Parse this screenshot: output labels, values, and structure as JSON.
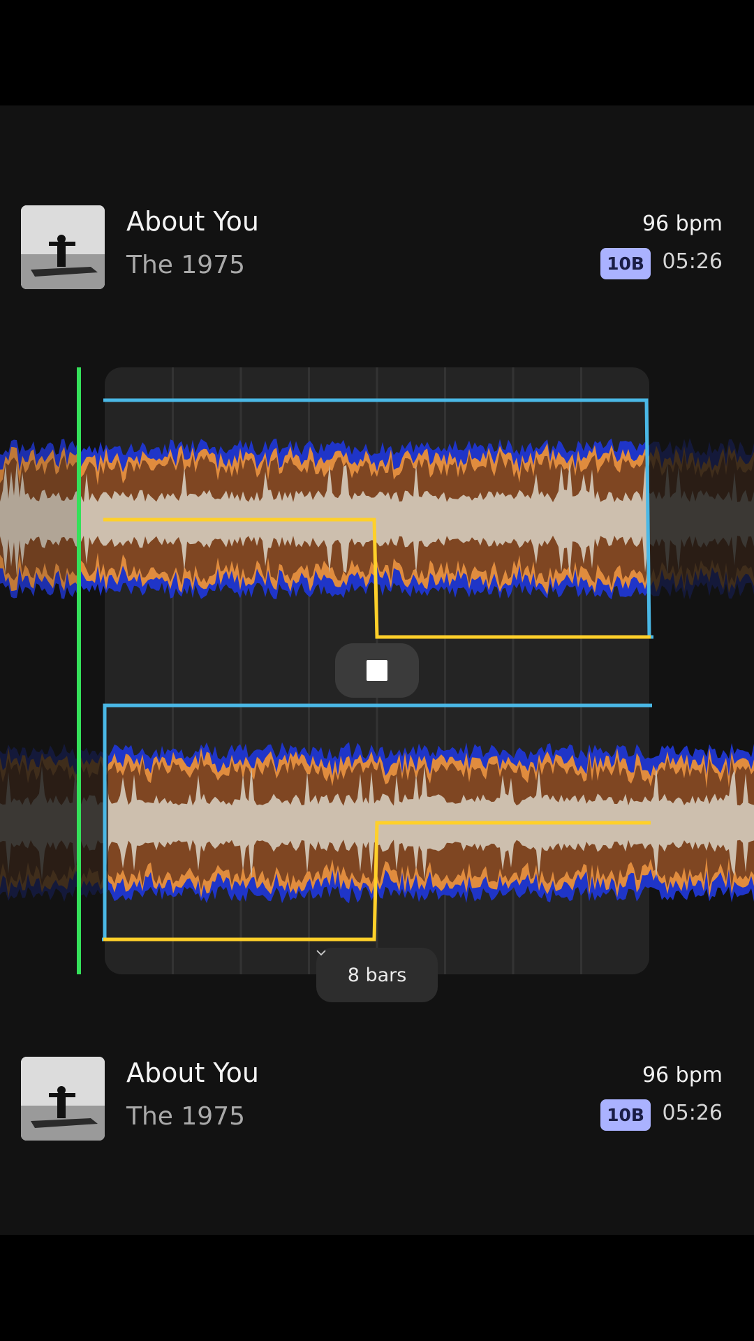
{
  "deck_a": {
    "title": "About You",
    "artist": "The 1975",
    "bpm": "96 bpm",
    "key": "10B",
    "duration": "05:26"
  },
  "deck_b": {
    "title": "About You",
    "artist": "The 1975",
    "bpm": "96 bpm",
    "key": "10B",
    "duration": "05:26"
  },
  "controls": {
    "bars_label": "8 bars"
  },
  "icons": {
    "stop": "stop-icon",
    "chevron": "chevron-down-icon",
    "art": "album-art"
  },
  "colors": {
    "background": "#121212",
    "grid_panel": "#242424",
    "playhead": "#35e05a",
    "volume_curve": "#4ab8e6",
    "eq_curve": "#ffd02a",
    "wave_low": "#1f35c8",
    "wave_mid": "#e08c3e",
    "wave_body": "#7f4622",
    "wave_high": "#cdbfae",
    "key_badge": "#aab2ff"
  }
}
